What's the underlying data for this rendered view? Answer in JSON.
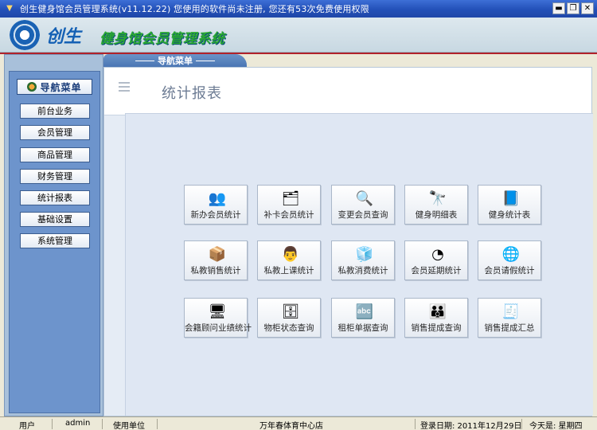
{
  "window": {
    "title": "创生健身馆会员管理系统(v11.12.22)  您使用的软件尚未注册, 您还有53次免费使用权限",
    "minimize": "▬",
    "restore": "❐",
    "close": "✕"
  },
  "banner": {
    "brand": "创生",
    "product": "健身馆会员管理系统"
  },
  "nav_tab": "导航菜单",
  "sidebar": {
    "title": "导航菜单",
    "items": [
      {
        "label": "前台业务"
      },
      {
        "label": "会员管理"
      },
      {
        "label": "商品管理"
      },
      {
        "label": "财务管理"
      },
      {
        "label": "统计报表"
      },
      {
        "label": "基础设置"
      },
      {
        "label": "系统管理"
      }
    ]
  },
  "main": {
    "title": "统计报表",
    "tiles": [
      {
        "label": "新办会员统计",
        "icon": "users-icon",
        "glyph": "👥"
      },
      {
        "label": "补卡会员统计",
        "icon": "card-icon",
        "glyph": "🗂"
      },
      {
        "label": "变更会员查询",
        "icon": "magnifier-icon",
        "glyph": "🔍"
      },
      {
        "label": "健身明细表",
        "icon": "binoculars-icon",
        "glyph": "🔭"
      },
      {
        "label": "健身统计表",
        "icon": "book-icon",
        "glyph": "📘"
      },
      {
        "label": "私教销售统计",
        "icon": "boxes-icon",
        "glyph": "📦"
      },
      {
        "label": "私教上课统计",
        "icon": "class-icon",
        "glyph": "👨"
      },
      {
        "label": "私教消费统计",
        "icon": "cubes-icon",
        "glyph": "🧊"
      },
      {
        "label": "会员延期统计",
        "icon": "pie-chart-icon",
        "glyph": "◔"
      },
      {
        "label": "会员请假统计",
        "icon": "globe-icon",
        "glyph": "🌐"
      },
      {
        "label": "会籍顾问业绩统计",
        "icon": "consultant-icon",
        "glyph": "🖥"
      },
      {
        "label": "物柜状态查询",
        "icon": "locker-icon",
        "glyph": "🗄"
      },
      {
        "label": "租柜单据查询",
        "icon": "abc-icon",
        "glyph": "🔤"
      },
      {
        "label": "销售提成查询",
        "icon": "sales-people-icon",
        "glyph": "👪"
      },
      {
        "label": "销售提成汇总",
        "icon": "summary-icon",
        "glyph": "🧾"
      }
    ]
  },
  "status": {
    "user_label": "用户",
    "user_value": "admin",
    "unit_label": "使用单位",
    "unit_value": "万年春体育中心店",
    "login_label": "登录日期: 2011年12月29日",
    "today_label": "今天是: 星期四"
  },
  "colors": {
    "titlebar": "#2350b8",
    "sidebar": "#6d94cc",
    "accent_red": "#b1222b",
    "content_bg": "#dfe7f3"
  }
}
